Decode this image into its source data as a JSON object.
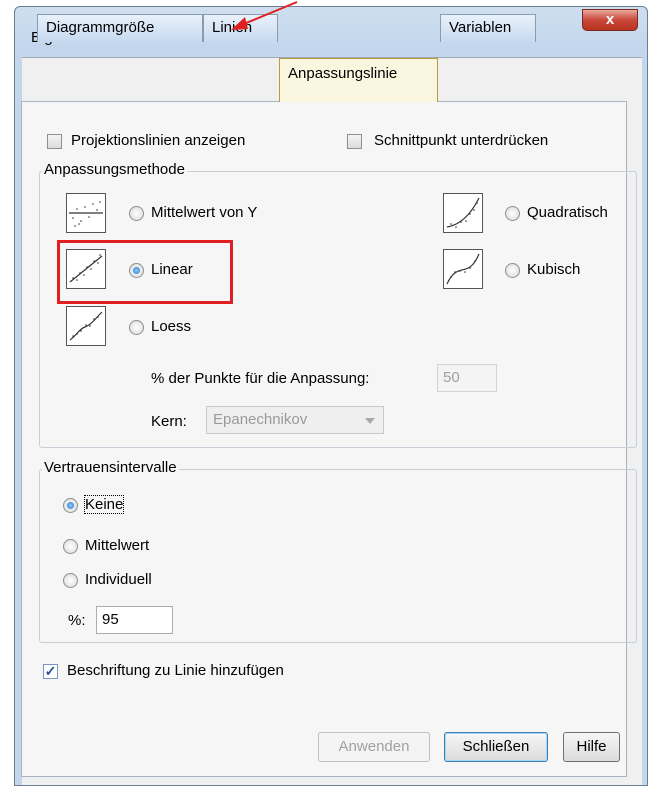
{
  "window": {
    "title": "Eigenschaften",
    "close_label": "x"
  },
  "tabs": [
    {
      "label": "Diagrammgröße"
    },
    {
      "label": "Linien"
    },
    {
      "label": "Anpassungslinie"
    },
    {
      "label": "Variablen"
    }
  ],
  "options": {
    "projection_lines": "Projektionslinien anzeigen",
    "suppress_intercept": "Schnittpunkt unterdrücken"
  },
  "fit_method": {
    "legend": "Anpassungsmethode",
    "mean_y": "Mittelwert von Y",
    "linear": "Linear",
    "loess": "Loess",
    "quadratic": "Quadratisch",
    "cubic": "Kubisch",
    "points_label": "% der Punkte für die Anpassung:",
    "points_value": "50",
    "kernel_label": "Kern:",
    "kernel_value": "Epanechnikov"
  },
  "confidence": {
    "legend": "Vertrauensintervalle",
    "none": "Keine",
    "mean": "Mittelwert",
    "individual": "Individuell",
    "percent_label": "%:",
    "percent_value": "95"
  },
  "add_label": "Beschriftung zu Linie hinzufügen",
  "buttons": {
    "apply": "Anwenden",
    "close": "Schließen",
    "help": "Hilfe"
  },
  "colors": {
    "highlight": "#e02020",
    "arrow": "#e02020"
  }
}
